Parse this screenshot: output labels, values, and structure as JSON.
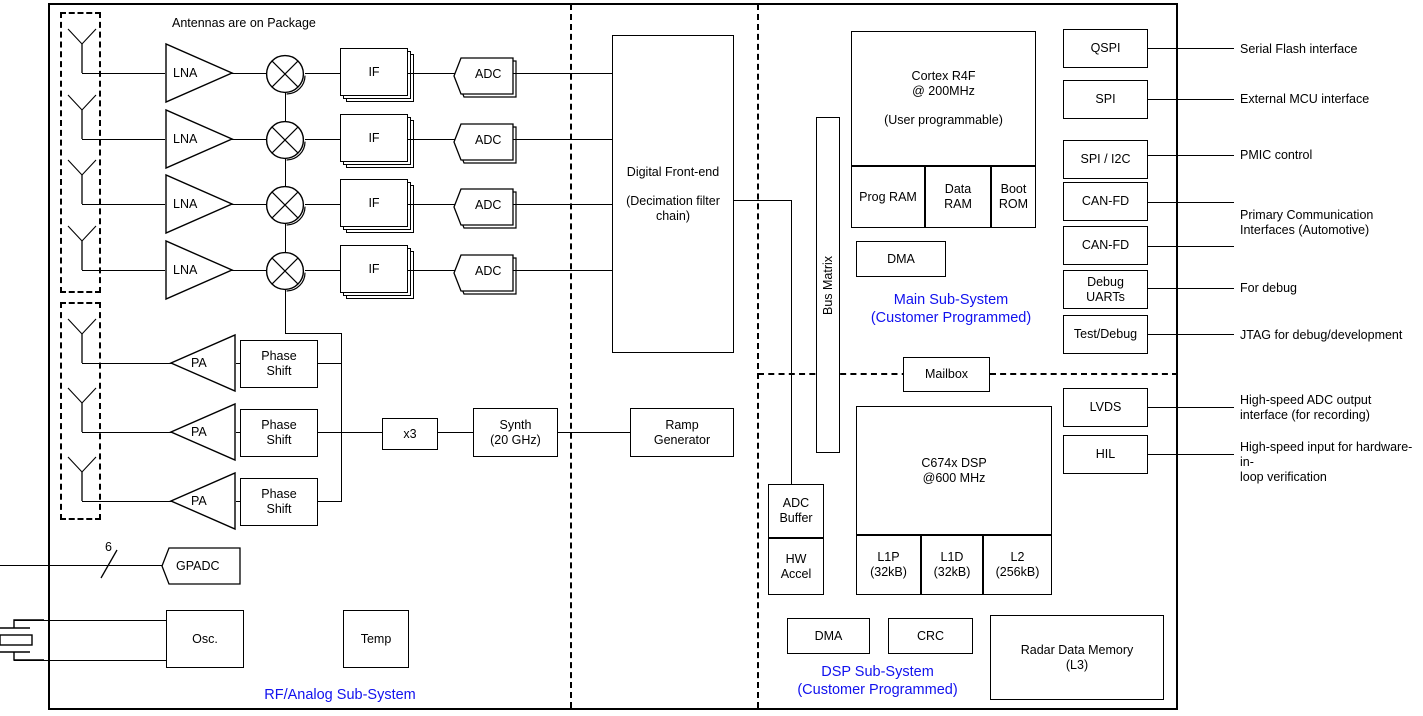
{
  "title_note": "Antennas are on Package",
  "subsystems": {
    "rf": "RF/Analog Sub-System",
    "main": "Main Sub-System\n(Customer Programmed)",
    "dsp": "DSP Sub-System\n(Customer Programmed)"
  },
  "rf": {
    "lna": [
      "LNA",
      "LNA",
      "LNA",
      "LNA"
    ],
    "if": [
      "IF",
      "IF",
      "IF",
      "IF"
    ],
    "adc": [
      "ADC",
      "ADC",
      "ADC",
      "ADC"
    ],
    "pa": [
      "PA",
      "PA",
      "PA"
    ],
    "phase_shift": [
      "Phase\nShift",
      "Phase\nShift",
      "Phase\nShift"
    ],
    "dfe": "Digital Front-end\n\n(Decimation filter\nchain)",
    "multiplier": "x3",
    "synth": "Synth\n(20 GHz)",
    "ramp": "Ramp\nGenerator",
    "gpadc": "GPADC",
    "gpadc_bus_width": "6",
    "osc": "Osc.",
    "temp": "Temp"
  },
  "main": {
    "cpu": "Cortex R4F\n@ 200MHz\n\n(User programmable)",
    "mem": [
      "Prog RAM",
      "Data\nRAM",
      "Boot\nROM"
    ],
    "dma": "DMA",
    "bus_matrix": "Bus Matrix",
    "mailbox": "Mailbox"
  },
  "dsp": {
    "core": "C674x DSP\n@600 MHz",
    "caches": [
      "L1P\n(32kB)",
      "L1D\n(32kB)",
      "L2\n(256kB)"
    ],
    "adc_buffer": "ADC\nBuffer",
    "hw_accel": "HW\nAccel",
    "dma": "DMA",
    "crc": "CRC",
    "radar_memory": "Radar Data Memory\n(L3)"
  },
  "interfaces": [
    {
      "name": "QSPI",
      "desc": "Serial Flash interface"
    },
    {
      "name": "SPI",
      "desc": "External MCU interface"
    },
    {
      "name": "SPI / I2C",
      "desc": "PMIC control"
    },
    {
      "name": "CAN-FD",
      "desc": ""
    },
    {
      "name": "CAN-FD",
      "desc": ""
    },
    {
      "name": "Debug\nUARTs",
      "desc": "For debug"
    },
    {
      "name": "Test/Debug",
      "desc": "JTAG for debug/development"
    },
    {
      "name": "LVDS",
      "desc": "High-speed ADC output\ninterface (for recording)"
    },
    {
      "name": "HIL",
      "desc": "High-speed input for hardware-in-\nloop verification"
    }
  ],
  "interface_group_label": "Primary Communication\nInterfaces (Automotive)",
  "colors": {
    "accent": "#1111ee",
    "line": "#000000",
    "background": "#ffffff"
  }
}
